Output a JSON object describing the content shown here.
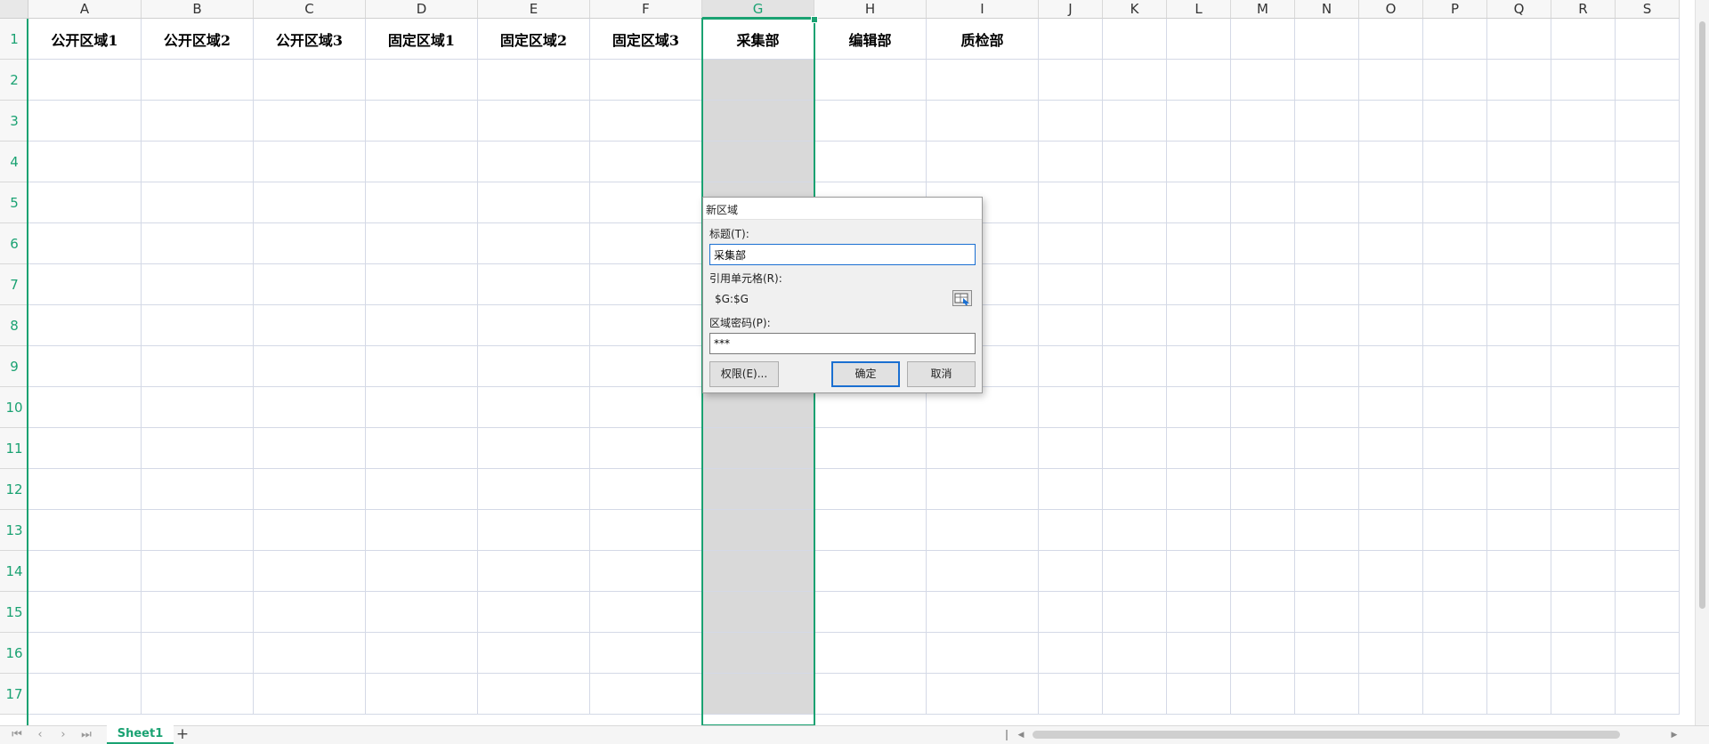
{
  "spreadsheet": {
    "columns": [
      "A",
      "B",
      "C",
      "D",
      "E",
      "F",
      "G",
      "H",
      "I",
      "J",
      "K",
      "L",
      "M",
      "N",
      "O",
      "P",
      "Q",
      "R",
      "S"
    ],
    "rows": [
      "1",
      "2",
      "3",
      "4",
      "5",
      "6",
      "7",
      "8",
      "9",
      "10",
      "11",
      "12",
      "13",
      "14",
      "15",
      "16",
      "17"
    ],
    "selected_column": "G",
    "header_cells": {
      "A1": "公开区域1",
      "B1": "公开区域2",
      "C1": "公开区域3",
      "D1": "固定区域1",
      "E1": "固定区域2",
      "F1": "固定区域3",
      "G1": "采集部",
      "H1": "编辑部",
      "I1": "质检部"
    },
    "accent_color": "#1aa272"
  },
  "sheet_tabs": {
    "active": "Sheet1",
    "add_label": "+",
    "nav_icons": [
      "first-sheet-icon",
      "prev-sheet-icon",
      "next-sheet-icon",
      "last-sheet-icon"
    ]
  },
  "dialog": {
    "title": "新区域",
    "title_label": "标题(T):",
    "title_value": "采集部",
    "ref_label": "引用单元格(R):",
    "ref_value": "$G:$G",
    "password_label": "区域密码(P):",
    "password_value": "***",
    "permissions_button": "权限(E)...",
    "ok_button": "确定",
    "cancel_button": "取消"
  }
}
